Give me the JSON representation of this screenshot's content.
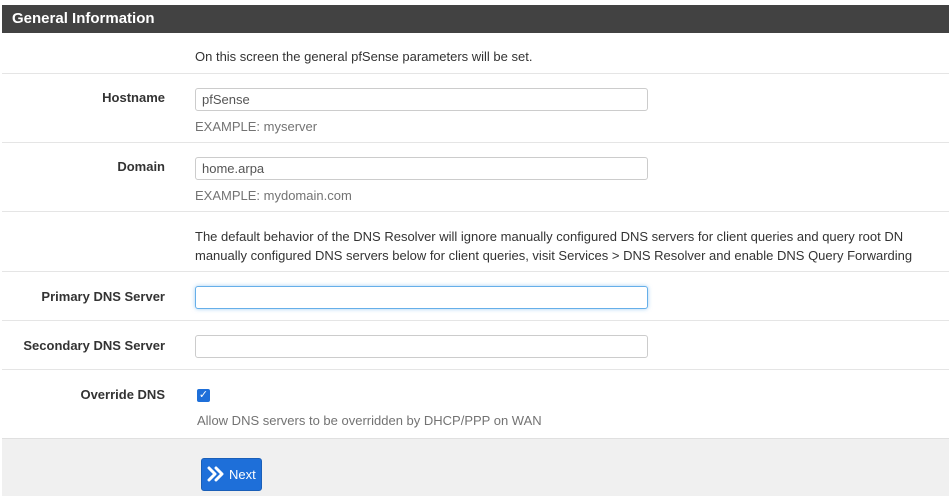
{
  "panel": {
    "title": "General Information"
  },
  "intro": {
    "text": "On this screen the general pfSense parameters will be set."
  },
  "hostname": {
    "label": "Hostname",
    "value": "pfSense",
    "help": "EXAMPLE: myserver"
  },
  "domain": {
    "label": "Domain",
    "value": "home.arpa",
    "help": "EXAMPLE: mydomain.com"
  },
  "dns_note": {
    "line1": "The default behavior of the DNS Resolver will ignore manually configured DNS servers for client queries and query root DN",
    "line2": "manually configured DNS servers below for client queries, visit Services > DNS Resolver and enable DNS Query Forwarding"
  },
  "primary_dns": {
    "label": "Primary DNS Server",
    "value": ""
  },
  "secondary_dns": {
    "label": "Secondary DNS Server",
    "value": ""
  },
  "override_dns": {
    "label": "Override DNS",
    "checked": true,
    "help": "Allow DNS servers to be overridden by DHCP/PPP on WAN"
  },
  "footer": {
    "next_label": "Next",
    "next_icon": "double-chevron-right-icon"
  },
  "colors": {
    "header_bg": "#424242",
    "accent": "#1e6fd9",
    "footer_bg": "#f0f0f0"
  }
}
